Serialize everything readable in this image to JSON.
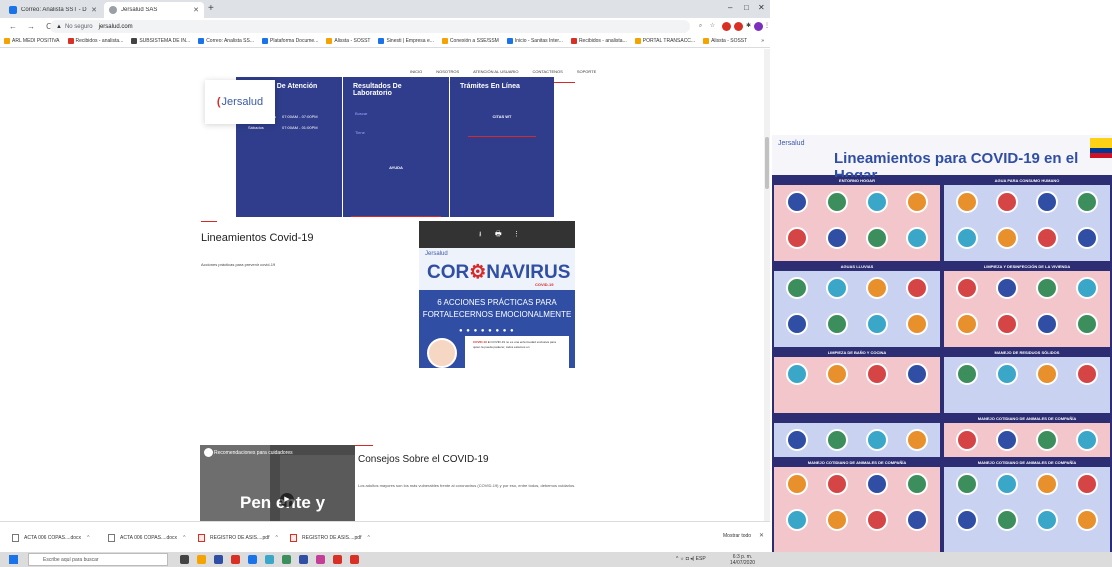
{
  "browser": {
    "tabs": [
      {
        "label": "Correo: Analista SST - Diana Be",
        "favicon_color": "#1a73e8"
      },
      {
        "label": "Jersalud SAS",
        "favicon_color": "#9aa0a6"
      }
    ],
    "new_tab": "+",
    "window_controls": {
      "minimize": "–",
      "maximize": "□",
      "close": "✕"
    },
    "nav": {
      "back": "←",
      "forward": "→",
      "reload": "C"
    },
    "address": {
      "security_icon": "▲",
      "security_label": "No seguro",
      "url": "jersalud.com"
    },
    "toolbar_icons": [
      "search-icon",
      "star-icon",
      "extension-icon",
      "puzzle-icon",
      "profile-icon",
      "menu-icon"
    ],
    "bookmarks": [
      {
        "label": "ARL MEDI POSITIVA",
        "color": "#f4a300"
      },
      {
        "label": "Recibidos - analista...",
        "color": "#d93025"
      },
      {
        "label": "SUBSISTEMA DE IN...",
        "color": "#444444"
      },
      {
        "label": "Correo: Analista SS...",
        "color": "#1a73e8"
      },
      {
        "label": "Plataforma Docume...",
        "color": "#1a73e8"
      },
      {
        "label": "Alissta - SOSST",
        "color": "#f4a300"
      },
      {
        "label": "Sinesti | Empresa e...",
        "color": "#1a73e8"
      },
      {
        "label": "Conexión a SSE/SSM",
        "color": "#f4a300"
      },
      {
        "label": "Inicio - Sanitas Inter...",
        "color": "#1a73e8"
      },
      {
        "label": "Recibidos - analista...",
        "color": "#d93025"
      },
      {
        "label": "PORTAL TRANSACC...",
        "color": "#f4a300"
      },
      {
        "label": "Alissta - SOSST",
        "color": "#f4a300"
      }
    ],
    "bookmarks_more": "»"
  },
  "site": {
    "nav": [
      "INICIO",
      "NOSOTROS",
      "ATENCIÓN AL USUARIO",
      "CONTACTENOS",
      "SOPORTE"
    ],
    "logo": "Jersalud",
    "horarios": {
      "title": "Horarios De Atención",
      "rows": [
        {
          "day": "Lunes - Viernes",
          "time": "07:00AM - 07:00PM"
        },
        {
          "day": "Sábados",
          "time": "07:00AM - 01:00PM"
        }
      ]
    },
    "resultados": {
      "title": "Resultados De Laboratorio",
      "links": [
        "Buscar",
        "Tiene"
      ],
      "button": "AYUDA"
    },
    "tramites": {
      "title": "Trámites En Línea",
      "button": "CITAS WT"
    },
    "lineamientos": {
      "title": "Lineamientos Covid-19",
      "text": "Acciones prácticas para prevenir covid-19"
    },
    "viewer": {
      "download_icon": "⭳",
      "print_icon": "🖶",
      "more_icon": "⋮",
      "logo": "Jersalud",
      "headline_a": "COR",
      "headline_b": "NAVIRUS",
      "badge": "COVID-19",
      "line1": "6 ACCIONES PRÁCTICAS PARA",
      "line2": "FORTALECERNOS EMOCIONALMENTE",
      "dots": "● ● ● ● ● ● ● ●",
      "card_bold": "COVID-19",
      "card_text": "El COVID-19 no es una enfermedad exclusiva para quien la pueda padecer, todos estamos en"
    },
    "video": {
      "title": "Recomendaciones para cuidadores",
      "overlay": "Pen   ente y",
      "play_icon": "▶"
    },
    "consejos": {
      "title": "Consejos Sobre el COVID-19",
      "text": "Los adultos mayores son los más vulnerables frente al coronavirus (COVID-19) y por eso, entre todos, debemos cuidarlos."
    }
  },
  "downloads": {
    "items": [
      {
        "label": "ACTA 006 COPAS....docx",
        "type": "docx"
      },
      {
        "label": "ACTA 006 COPAS....docx",
        "type": "docx"
      },
      {
        "label": "REGISTRO DE ASIS....pdf",
        "type": "pdf"
      },
      {
        "label": "REGISTRO DE ASIS....pdf",
        "type": "pdf"
      }
    ],
    "caret": "^",
    "show_all": "Mostrar todo",
    "close": "✕"
  },
  "taskbar": {
    "search_placeholder": "Escribe aquí para buscar",
    "tray": "^ ☼ ◘ ◂) ESP",
    "time": "6:3 p. m.",
    "date": "14/07/2020",
    "app_colors": [
      "#444444",
      "#f4a300",
      "#2f4ea4",
      "#d93025",
      "#1a73e8",
      "#3aa7c9",
      "#3c8f5c",
      "#2f4ea4",
      "#c43e98",
      "#d93025",
      "#d93025"
    ]
  },
  "poster": {
    "logo": "Jersalud",
    "title": "Lineamientos para COVID-19 en el Hogar",
    "sections": [
      "ENTORNO HOGAR",
      "AGUA PARA CONSUMO HUMANO",
      "AGUAS LLUVIAS",
      "LIMPIEZA Y DESINFECCIÓN DE LA VIVIENDA",
      "LIMPIEZA DE BAÑO Y COCINA",
      "MANEJO DE RESIDUOS SÓLIDOS",
      "MANEJO COTIDIANO DE ANIMALES DE COMPAÑÍA",
      "MANEJO COTIDIANO DE ANIMALES DE COMPAÑÍA",
      "MANEJO COTIDIANO DE ANIMALES DE COMPAÑÍA"
    ]
  }
}
